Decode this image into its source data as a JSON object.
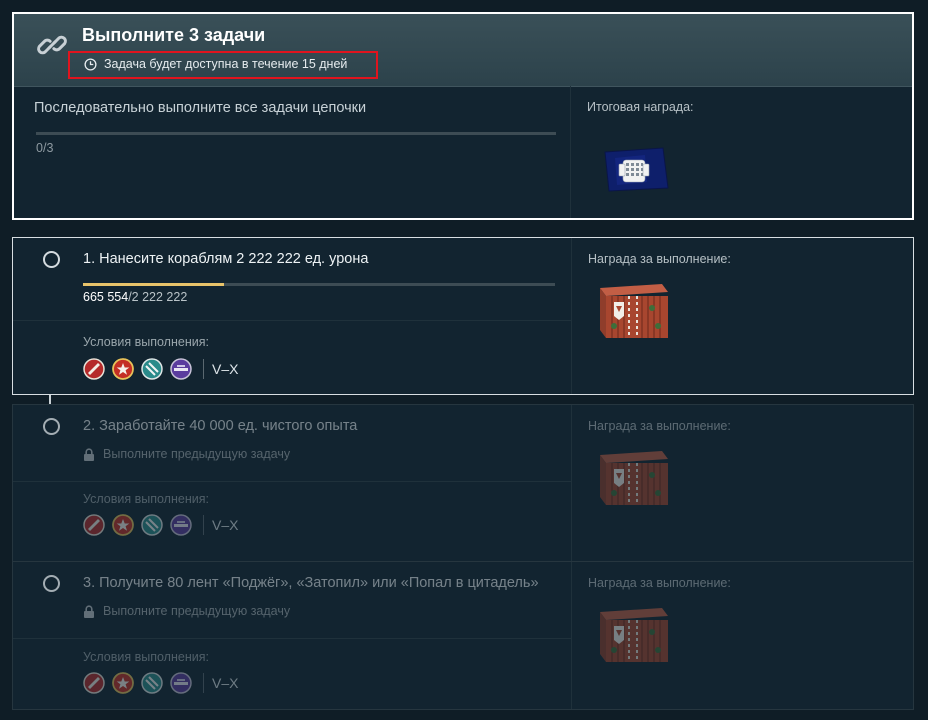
{
  "chain": {
    "title": "Выполните 3 задачи",
    "timer_text": "Задача будет доступна в течение 15 дней",
    "description": "Последовательно выполните все задачи цепочки",
    "progress_current": "0",
    "progress_total": "3",
    "progress_fraction": 0,
    "reward_label": "Итоговая награда:"
  },
  "tasks": [
    {
      "title": "1. Нанесите кораблям 2 222 222 ед. урона",
      "progress_current": "665 554",
      "progress_total": "2 222 222",
      "progress_fraction": 0.2995,
      "locked_text": "",
      "conditions_label": "Условия выполнения:",
      "tier_text": "V–X",
      "reward_label": "Награда за выполнение:"
    },
    {
      "title": "2. Заработайте 40 000 ед. чистого опыта",
      "locked_text": "Выполните предыдущую задачу",
      "conditions_label": "Условия выполнения:",
      "tier_text": "V–X",
      "reward_label": "Награда за выполнение:"
    },
    {
      "title": "3. Получите 80 лент «Поджёг», «Затопил» или «Попал в цитадель»",
      "locked_text": "Выполните предыдущую задачу",
      "conditions_label": "Условия выполнения:",
      "tier_text": "V–X",
      "reward_label": "Награда за выполнение:"
    }
  ],
  "count_separator": "/",
  "icons": {
    "chain": "chain-link-icon",
    "timer": "clock-icon",
    "lock": "lock-icon",
    "class_icons": [
      "destroyer-class-icon",
      "cruiser-class-icon",
      "battleship-class-icon",
      "aircraft-carrier-class-icon"
    ],
    "chain_reward": "flag-reward-icon",
    "task_reward": "container-crate-icon"
  },
  "colors": {
    "progress": "#e8c36a",
    "highlight": "#e0141e"
  }
}
